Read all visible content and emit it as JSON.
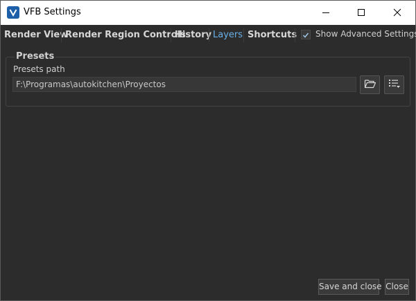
{
  "window": {
    "title": "VFB Settings",
    "icon": "vray-logo-icon",
    "controls": [
      "minimize-icon",
      "maximize-icon",
      "close-icon"
    ]
  },
  "tabs": [
    {
      "label": "Render View",
      "active": false
    },
    {
      "label": "Render Region Controls",
      "active": false
    },
    {
      "label": "History",
      "active": false
    },
    {
      "label": "Layers",
      "active": true
    },
    {
      "label": "Shortcuts",
      "active": false
    }
  ],
  "advanced": {
    "label": "Show Advanced Settings",
    "checked": true
  },
  "presets": {
    "group_title": "Presets",
    "path_label": "Presets path",
    "path_value": "F:\\Programas\\autokitchen\\Proyectos",
    "folder_icon": "folder-open-icon",
    "list_icon": "list-menu-icon"
  },
  "footer": {
    "save_label": "Save and close",
    "close_label": "Close"
  },
  "colors": {
    "background": "#2c2c2c",
    "active_tab": "#6ab0e6",
    "text": "#d6d6d6",
    "titlebar": "#ffffff"
  }
}
